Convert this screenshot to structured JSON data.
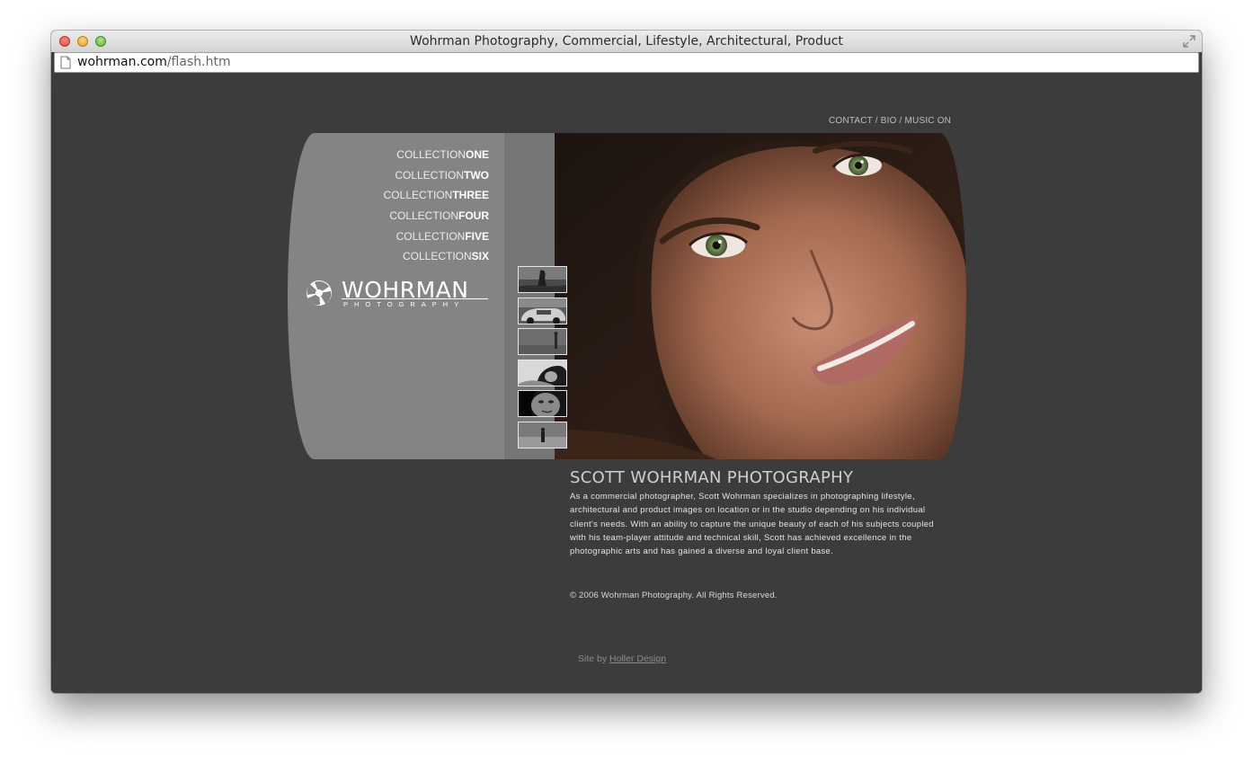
{
  "browser": {
    "title": "Wohrman Photography, Commercial, Lifestyle, Architectural, Product",
    "url_domain": "wohrman.com",
    "url_path": "/flash.htm"
  },
  "page": {
    "top_links": "CONTACT / BIO / MUSIC ON",
    "menu": [
      {
        "thin": "COLLECTION",
        "bold": "ONE"
      },
      {
        "thin": "COLLECTION",
        "bold": "TWO"
      },
      {
        "thin": "COLLECTION",
        "bold": "THREE"
      },
      {
        "thin": "COLLECTION",
        "bold": "FOUR"
      },
      {
        "thin": "COLLECTION",
        "bold": "FIVE"
      },
      {
        "thin": "COLLECTION",
        "bold": "SIX"
      }
    ],
    "logo": {
      "word": "WOHRMAN",
      "sub": "PHOTOGRAPHY"
    },
    "headline": "SCOTT WOHRMAN PHOTOGRAPHY",
    "bio": "As a commercial photographer, Scott Wohrman specializes in photographing lifestyle, architectural and product images on location or in the studio depending on his individual client's needs. With an ability to capture the unique beauty of each of his subjects coupled with his team-player attitude and technical skill, Scott has achieved excellence in the photographic arts and has gained a diverse and loyal client base.",
    "copyright": "© 2006 Wohrman Photography.  All Rights  Reserved.",
    "site_by_prefix": "Site by",
    "site_by_link": "Holler Design"
  },
  "colors": {
    "background": "#3c3c3c",
    "panel": "#858484",
    "strip": "#777676"
  }
}
